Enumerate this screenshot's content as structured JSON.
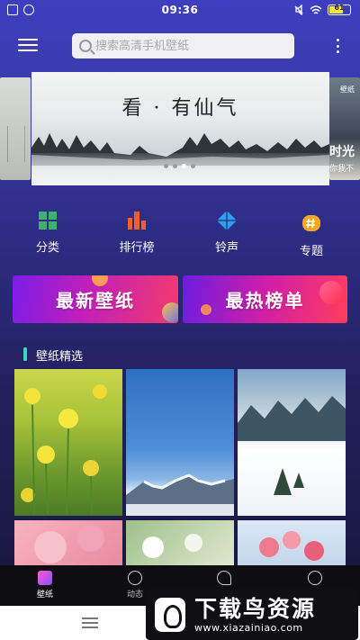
{
  "status_bar": {
    "time": "09:36",
    "battery": "61"
  },
  "search": {
    "placeholder": "搜索高清手机壁纸"
  },
  "banner": {
    "title": "看 · 有仙气",
    "right_card_tag": "壁纸",
    "right_card_title": "时光",
    "right_card_sub": "你我不"
  },
  "categories": [
    {
      "label": "分类",
      "icon": "grid-icon",
      "color": "#3bb36b"
    },
    {
      "label": "排行榜",
      "icon": "bar-chart-icon",
      "color": "#f0602a"
    },
    {
      "label": "铃声",
      "icon": "ringtone-diamond-icon",
      "color": "#2f9df5"
    },
    {
      "label": "专题",
      "icon": "topic-hash-icon",
      "color": "#f5a623"
    }
  ],
  "promos": {
    "newest": "最新壁纸",
    "hottest": "最热榜单"
  },
  "section": {
    "title": "壁纸精选",
    "accent": "#3cd6b8"
  },
  "bottom_nav": [
    {
      "label": "壁纸",
      "icon": "wallpaper-icon",
      "active": true
    },
    {
      "label": "动态",
      "icon": "chat-bubble-icon",
      "active": false
    },
    {
      "label": "",
      "icon": "heart-icon",
      "active": false
    },
    {
      "label": "",
      "icon": "profile-icon",
      "active": false
    }
  ],
  "watermark": {
    "text": "下载鸟资源",
    "url": "www.xiazainiao.com"
  }
}
